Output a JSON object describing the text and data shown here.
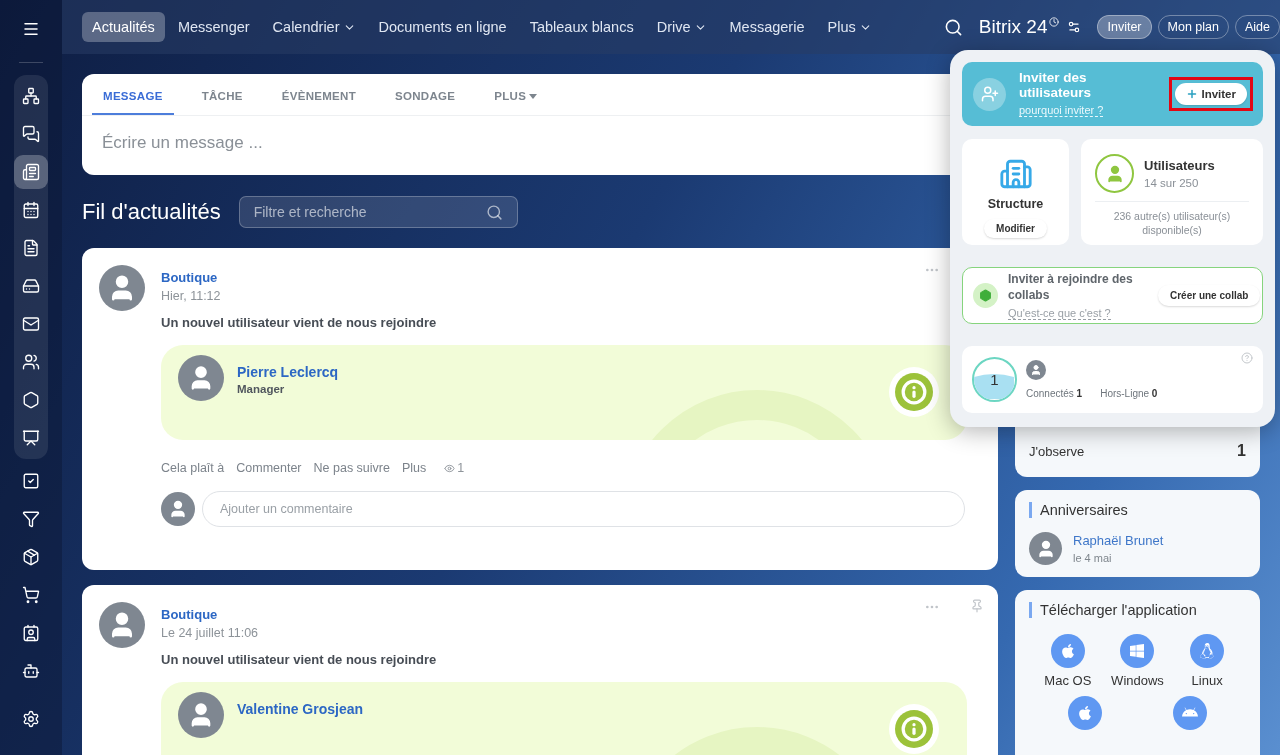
{
  "sidebar": {
    "pinned": [
      {
        "kind": "network",
        "selected": false
      },
      {
        "kind": "chat",
        "selected": false
      },
      {
        "kind": "news",
        "selected": true
      },
      {
        "kind": "calendar",
        "selected": false
      },
      {
        "kind": "document",
        "selected": false
      },
      {
        "kind": "drive",
        "selected": false
      },
      {
        "kind": "mail",
        "selected": false
      },
      {
        "kind": "contacts",
        "selected": false
      },
      {
        "kind": "hexagon",
        "selected": false
      },
      {
        "kind": "board",
        "selected": false
      }
    ],
    "more": [
      {
        "kind": "tasks",
        "selected": false
      },
      {
        "kind": "funnel",
        "selected": false
      },
      {
        "kind": "box",
        "selected": false
      },
      {
        "kind": "cart",
        "selected": false
      },
      {
        "kind": "card",
        "selected": false
      },
      {
        "kind": "bot",
        "selected": false
      }
    ],
    "bottom": [
      {
        "kind": "settings",
        "selected": false
      }
    ]
  },
  "nav": [
    {
      "label": "Actualités",
      "selected": true,
      "dropdown": false
    },
    {
      "label": "Messenger",
      "selected": false,
      "dropdown": false
    },
    {
      "label": "Calendrier",
      "selected": false,
      "dropdown": true
    },
    {
      "label": "Documents en ligne",
      "selected": false,
      "dropdown": false
    },
    {
      "label": "Tableaux blancs",
      "selected": false,
      "dropdown": false
    },
    {
      "label": "Drive",
      "selected": false,
      "dropdown": true
    },
    {
      "label": "Messagerie",
      "selected": false,
      "dropdown": false
    },
    {
      "label": "Plus",
      "selected": false,
      "dropdown": true
    }
  ],
  "header": {
    "logo": "Bitrix 24",
    "buttons": [
      {
        "label": "Inviter",
        "selected": true
      },
      {
        "label": "Mon plan",
        "selected": false
      },
      {
        "label": "Aide",
        "selected": false
      }
    ]
  },
  "composer": {
    "tabs": [
      {
        "label": "MESSAGE",
        "selected": true,
        "dropdown": false
      },
      {
        "label": "TÂCHE",
        "selected": false,
        "dropdown": false
      },
      {
        "label": "ÉVÈNEMENT",
        "selected": false,
        "dropdown": false
      },
      {
        "label": "SONDAGE",
        "selected": false,
        "dropdown": false
      },
      {
        "label": "PLUS",
        "selected": false,
        "dropdown": true
      }
    ],
    "placeholder": "Écrire un message ..."
  },
  "feed": {
    "title": "Fil d'actualités",
    "filter_placeholder": "Filtre et recherche"
  },
  "posts": [
    {
      "author": "Boutique",
      "time": "Hier, 11:12",
      "text": "Un nouvel utilisateur vient de nous rejoindre",
      "user": {
        "name": "Pierre Leclercq",
        "role": "Manager"
      },
      "actions": [
        "Cela plaît à",
        "Commenter",
        "Ne pas suivre",
        "Plus"
      ],
      "views": "1",
      "comment_placeholder": "Ajouter un commentaire"
    },
    {
      "author": "Boutique",
      "time": "Le 24 juillet 11:06",
      "text": "Un nouvel utilisateur vient de nous rejoindre",
      "user": {
        "name": "Valentine Grosjean"
      },
      "pin": true
    }
  ],
  "right": {
    "watch": {
      "label": "J'observe",
      "count": "1"
    },
    "birthdays": {
      "title": "Anniversaires",
      "people": [
        {
          "name": "Raphaël Brunet",
          "date": "le 4 mai"
        }
      ]
    },
    "apps": {
      "title": "Télécharger l'application",
      "items": [
        {
          "kind": "apple",
          "label": "Mac OS"
        },
        {
          "kind": "windows",
          "label": "Windows"
        },
        {
          "kind": "linux",
          "label": "Linux"
        },
        {
          "kind": "apple"
        },
        {
          "kind": "android"
        }
      ]
    }
  },
  "popup": {
    "invite": {
      "title": "Inviter des utilisateurs",
      "link": "pourquoi inviter ?",
      "button": "Inviter",
      "highlighted": true
    },
    "structure": {
      "title": "Structure",
      "button": "Modifier"
    },
    "users": {
      "title": "Utilisateurs",
      "count": "14 sur 250",
      "note": "236 autre(s) utilisateur(s) disponible(s)"
    },
    "collab": {
      "title": "Inviter à rejoindre des collabs",
      "link": "Qu'est-ce que c'est ?",
      "button": "Créer une collab"
    },
    "online": {
      "count": "1",
      "stats": [
        {
          "label": "Connectés",
          "value": "1"
        },
        {
          "label": "Hors-Ligne",
          "value": "0"
        }
      ]
    }
  }
}
